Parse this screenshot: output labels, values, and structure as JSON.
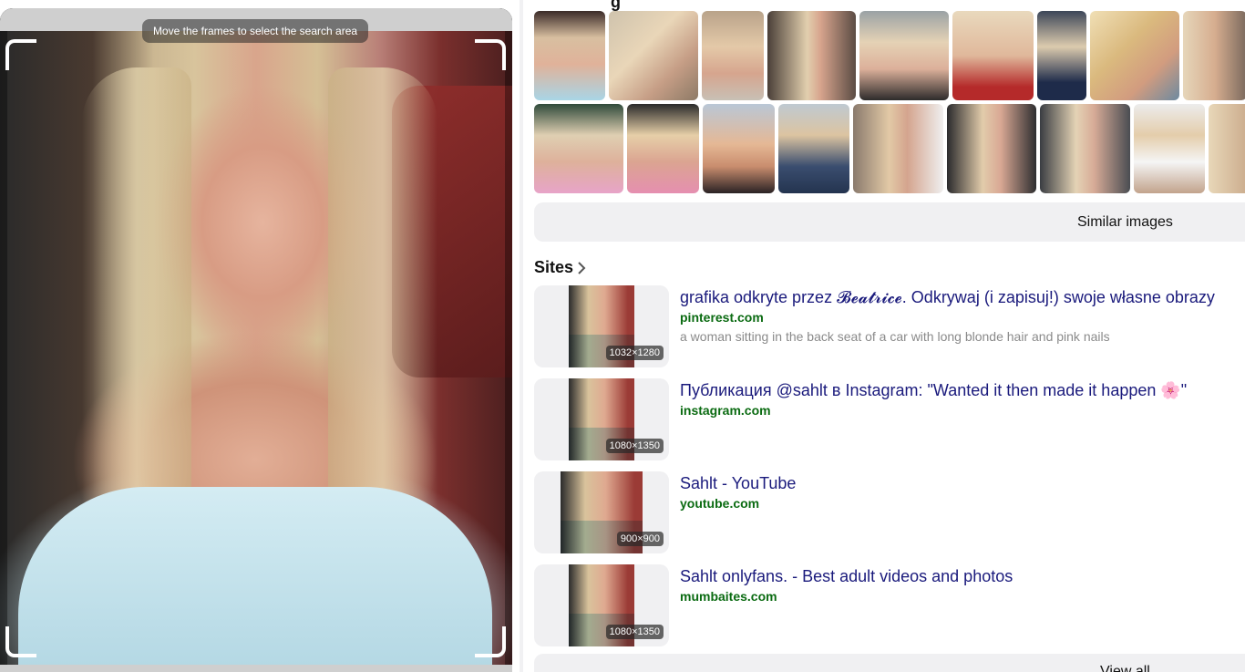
{
  "viewer": {
    "hint": "Move the frames to select the search area"
  },
  "section_heading_cut": "g",
  "similar_images_button": "Similar images",
  "sites_heading": "Sites",
  "sites": [
    {
      "title": "grafika odkryte przez 𝓑𝓮𝓪𝓽𝓻𝓲𝓬𝓮. Odkrywaj (i zapisuj!) swoje własne obrazy",
      "domain": "pinterest.com",
      "description": "a woman sitting in the back seat of a car with long blonde hair and pink nails",
      "size": "1032×1280"
    },
    {
      "title": "Публикация @sahlt в Instagram: \"Wanted it then made it happen 🌸\"",
      "domain": "instagram.com",
      "description": "",
      "size": "1080×1350"
    },
    {
      "title": "Sahlt - YouTube",
      "domain": "youtube.com",
      "description": "",
      "size": "900×900"
    },
    {
      "title": "Sahlt onlyfans. - Best adult videos and photos",
      "domain": "mumbaites.com",
      "description": "",
      "size": "1080×1350"
    }
  ],
  "view_all_button": "View all"
}
